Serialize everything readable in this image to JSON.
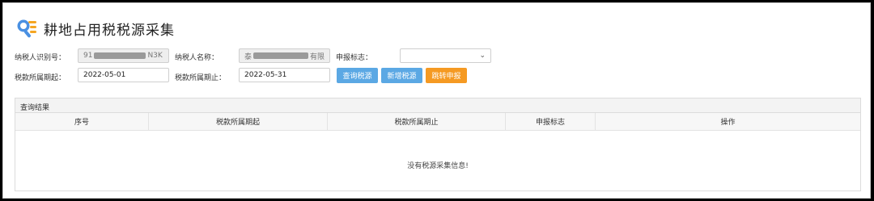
{
  "page": {
    "title": "耕地占用税税源采集"
  },
  "form": {
    "taxpayer_id_label": "纳税人识别号：",
    "taxpayer_id_prefix": "91",
    "taxpayer_id_suffix": "N3K",
    "taxpayer_name_label": "纳税人名称：",
    "taxpayer_name_prefix": "泰",
    "taxpayer_name_suffix": "有限",
    "declare_flag_label": "申报标志：",
    "declare_flag_value": "",
    "period_start_label": "税款所属期起：",
    "period_start_value": "2022-05-01",
    "period_end_label": "税款所属期止：",
    "period_end_value": "2022-05-31"
  },
  "buttons": {
    "query": "查询税源",
    "add": "新增税源",
    "jump": "跳转申报"
  },
  "results": {
    "header": "查询结果",
    "columns": [
      "序号",
      "税款所属期起",
      "税款所属期止",
      "申报标志",
      "操作"
    ],
    "empty_text": "没有税源采集信息!"
  },
  "colors": {
    "blue_button": "#5ba8e4",
    "orange_button": "#f59a23"
  },
  "icons": {
    "title_icon": "search-list-icon",
    "select_chevron": "chevron-down-icon"
  }
}
